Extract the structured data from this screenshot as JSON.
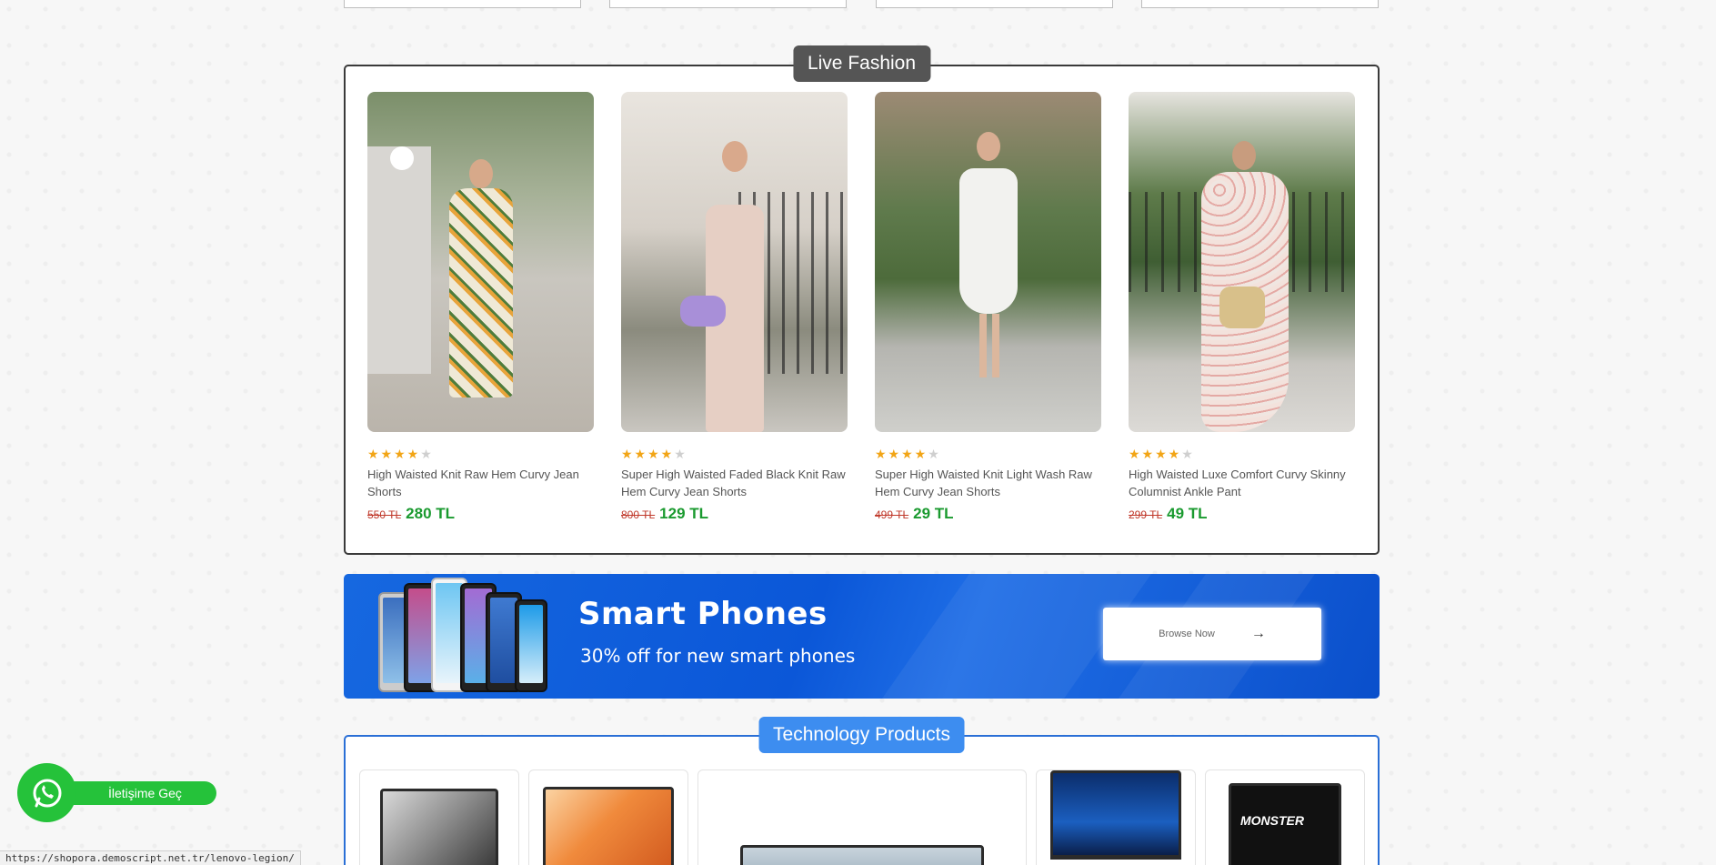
{
  "fashion": {
    "title": "Live Fashion",
    "products": [
      {
        "name": "High Waisted Knit Raw Hem Curvy Jean Shorts",
        "old_price": "550 TL",
        "price": "280 TL",
        "rating": 4
      },
      {
        "name": "Super High Waisted Faded Black Knit Raw Hem Curvy Jean Shorts",
        "old_price": "800 TL",
        "price": "129 TL",
        "rating": 4
      },
      {
        "name": "Super High Waisted Knit Light Wash Raw Hem Curvy Jean Shorts",
        "old_price": "499 TL",
        "price": "29 TL",
        "rating": 4
      },
      {
        "name": "High Waisted Luxe Comfort Curvy Skinny Columnist Ankle Pant",
        "old_price": "299 TL",
        "price": "49 TL",
        "rating": 4
      }
    ]
  },
  "banner": {
    "title": "Smart Phones",
    "subtitle": "30% off for new smart phones",
    "button_label": "Browse Now"
  },
  "tech": {
    "title": "Technology Products"
  },
  "whatsapp": {
    "label": "İletişime Geç"
  },
  "status_url": "https://shopora.demoscript.net.tr/lenovo-legion/",
  "colors": {
    "price_green": "#1a9a2f",
    "old_price_red": "#c0392b",
    "star": "#f2a516",
    "banner_blue": "#0b57d8",
    "tech_blue": "#3d8df0",
    "whatsapp_green": "#25c23a"
  }
}
